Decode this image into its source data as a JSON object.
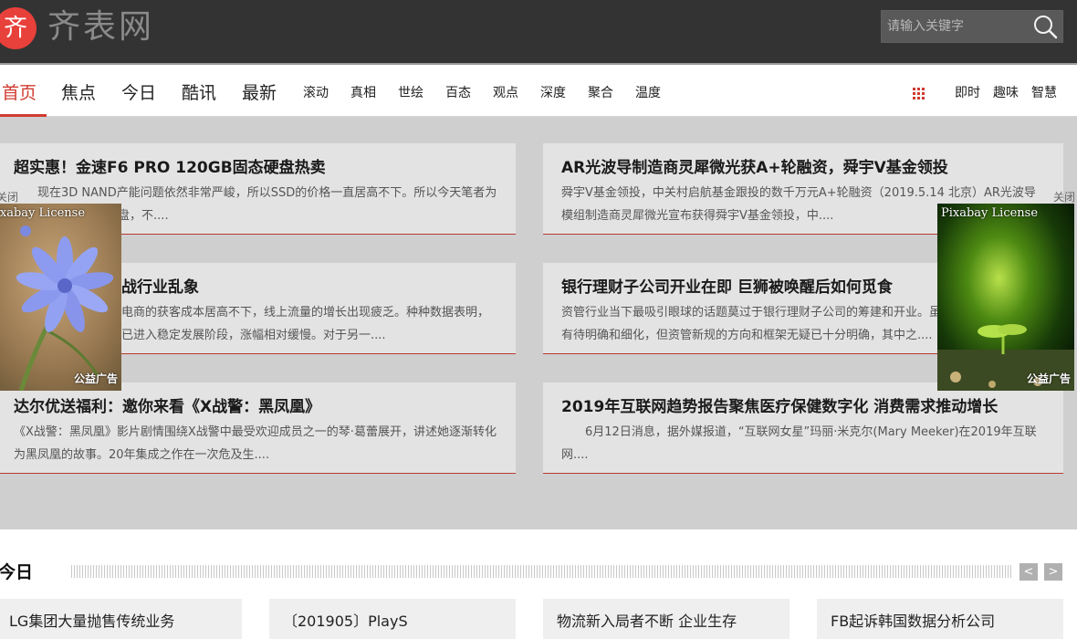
{
  "header": {
    "logo_char": "齐",
    "logo_text": "齐表网",
    "search_placeholder": "请输入关键字",
    "colors": {
      "bar": "#333333",
      "logo": "#e8403a",
      "accent": "#d03a2f"
    }
  },
  "nav": {
    "main": [
      "首页",
      "焦点",
      "今日",
      "酷讯",
      "最新"
    ],
    "secondary": [
      "滚动",
      "真相",
      "世绘",
      "百态",
      "观点",
      "深度",
      "聚合",
      "温度"
    ],
    "right": [
      "即时",
      "趣味",
      "智慧"
    ],
    "active": "首页",
    "menu_icon": "grid-icon"
  },
  "featured": [
    {
      "title": "超实惠！金速F6 PRO 120GB固态硬盘热卖",
      "desc": "现在3D NAND产能问题依然非常严峻，所以SSD的价格一直居高不下。所以今天笔者为 PRO 120GB固态硬盘，不...."
    },
    {
      "title": "AR光波导制造商灵犀微光获A+轮融资，舜宇V基金领投",
      "desc": "舜宇V基金领投，中关村启航基金跟投的数千万元A+轮融资（2019.5.14 北京）AR光波导模组制造商灵犀微光宣布获得舜宇V基金领投，中...."
    },
    {
      "title": "战行业乱象",
      "desc": "电商的获客成本居高不下，线上流量的增长出现疲乏。种种数据表明，已进入稳定发展阶段，涨幅相对缓慢。对于另一...."
    },
    {
      "title": "银行理财子公司开业在即 巨狮被唤醒后如何觅食",
      "desc": "资管行业当下最吸引眼球的话题莫过于银行理财子公司的筹建和开业。虽有待明确和细化，但资管新规的方向和框架无疑已十分明确，其中之...."
    },
    {
      "title": "达尔优送福利：邀你来看《X战警：黑凤凰》",
      "desc": "《X战警：黑凤凰》影片剧情围绕X战警中最受欢迎成员之一的琴·葛蕾展开，讲述她逐渐转化为黑凤凰的故事。20年集成之作在一次危及生...."
    },
    {
      "title": "2019年互联网趋势报告聚焦医疗保健数字化 消费需求推动增长",
      "desc": "6月12日消息，据外媒报道，“互联网女星”玛丽·米克尔(Mary Meeker)在2019年互联网...."
    }
  ],
  "ads": {
    "left": {
      "caption": "Pixabay License",
      "tag": "公益广告",
      "close": "关闭",
      "image": "blue-flower"
    },
    "right": {
      "caption": "Pixabay License",
      "tag": "公益广告",
      "close": "关闭",
      "image": "green-sprout"
    }
  },
  "today": {
    "title": "今日",
    "prev": "<",
    "next": ">",
    "items": [
      "LG集团大量抛售传统业务",
      "〔201905〕PlayS",
      "物流新入局者不断 企业生存",
      "FB起诉韩国数据分析公司"
    ]
  }
}
